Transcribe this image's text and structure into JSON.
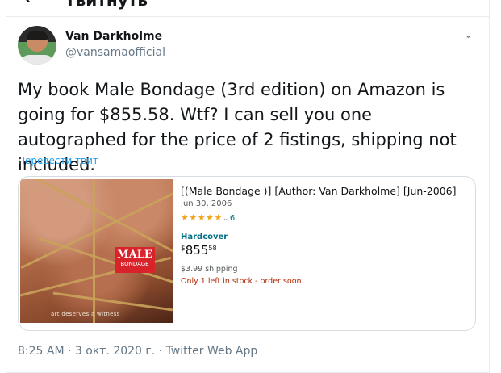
{
  "header": {
    "back_icon": "back-arrow-icon",
    "title": "Твитнуть"
  },
  "tweet": {
    "author": {
      "name": "Van Darkholme",
      "handle": "@vansamaofficial"
    },
    "more_icon": "chevron-down-icon",
    "text": "My book Male Bondage (3rd edition) on Amazon is going for $855.58. Wtf? I can sell you one autographed for the price of 2 fistings, shipping not included.",
    "translate_label": "Перевести твит",
    "meta": "8:25 AM · 3 окт. 2020 г. · Twitter Web App"
  },
  "card": {
    "cover": {
      "badge_main": "MALE",
      "badge_sub": "BONDAGE",
      "tagline": "art deserves a witness"
    },
    "title": "[(Male Bondage )] [Author: Van Darkholme] [Jun-2006]",
    "date": "Jun 30, 2006",
    "rating": 5,
    "stars": "★★★★★",
    "review_count": "6",
    "format": "Hardcover",
    "price_symbol": "$",
    "price_whole": "855",
    "price_fraction": "58",
    "shipping": "$3.99 shipping",
    "stock": "Only 1 left in stock - order soon."
  },
  "colors": {
    "link": "#1da1f2",
    "stars": "#f0a41c",
    "stock": "#b12704",
    "amazon_link": "#007185"
  }
}
